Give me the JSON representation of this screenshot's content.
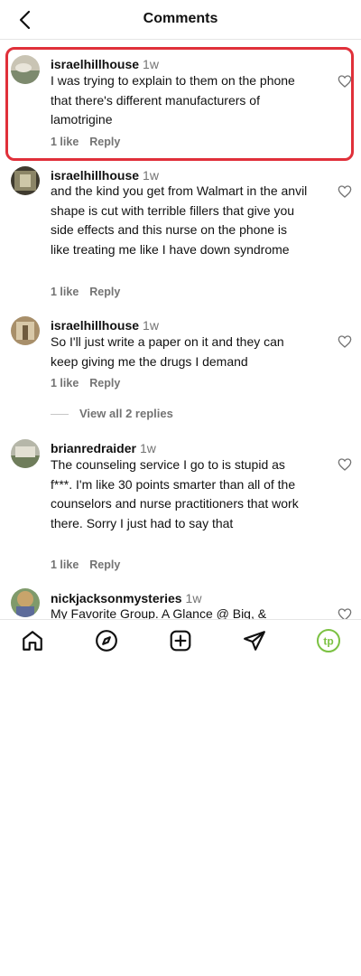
{
  "header": {
    "title": "Comments",
    "back_icon": "chevron-left-icon"
  },
  "comments": [
    {
      "username": "israelhillhouse",
      "time": "1w",
      "text": "I was trying to explain to them on the phone that there's different manufacturers of lamotrigine",
      "likes": "1 like",
      "reply": "Reply",
      "highlighted": true
    },
    {
      "username": "israelhillhouse",
      "time": "1w",
      "text": "and the kind you get from Walmart in the anvil shape is cut with terrible fillers that give you side effects and this nurse on the phone is like treating me like I have down syndrome",
      "likes": "1 like",
      "reply": "Reply"
    },
    {
      "username": "israelhillhouse",
      "time": "1w",
      "text": "So I'll just write a paper on it and they can keep giving me the drugs I demand",
      "likes": "1 like",
      "reply": "Reply"
    },
    {
      "username": "brianredraider",
      "time": "1w",
      "text": "The counseling service I go to is stupid as f***. I'm like 30 points smarter than all of the counselors and nurse practitioners that work there. Sorry I just had to say that",
      "likes": "1 like",
      "reply": "Reply"
    },
    {
      "username": "nickjacksonmysteries",
      "time": "1w",
      "text": "My Favorite Group. A Glance @ Big, &"
    }
  ],
  "view_replies": "View all 2 replies",
  "colors": {
    "highlight": "#e0303a",
    "muted": "#737373",
    "profile_accent": "#7bc142"
  },
  "navbar": {
    "items": [
      "home-icon",
      "explore-compass-icon",
      "create-plus-icon",
      "direct-send-icon",
      "profile-avatar-icon"
    ],
    "profile_initials": "tp"
  }
}
